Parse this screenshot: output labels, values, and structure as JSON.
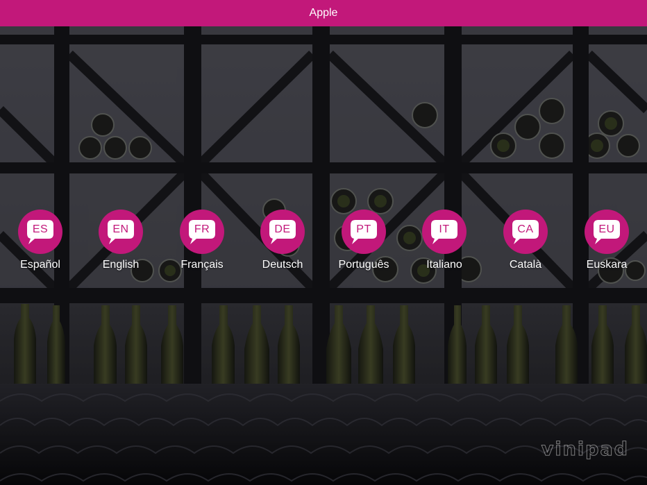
{
  "header": {
    "title": "Apple"
  },
  "colors": {
    "accent": "#c2187a",
    "text_on_accent": "#ffffff"
  },
  "background": {
    "description_icon": "wine-rack-background"
  },
  "languages": [
    {
      "code": "ES",
      "label": "Español"
    },
    {
      "code": "EN",
      "label": "English"
    },
    {
      "code": "FR",
      "label": "Français"
    },
    {
      "code": "DE",
      "label": "Deutsch"
    },
    {
      "code": "PT",
      "label": "Português"
    },
    {
      "code": "IT",
      "label": "Italiano"
    },
    {
      "code": "CA",
      "label": "Català"
    },
    {
      "code": "EU",
      "label": "Euskara"
    }
  ],
  "watermark": {
    "text": "vinipad"
  }
}
